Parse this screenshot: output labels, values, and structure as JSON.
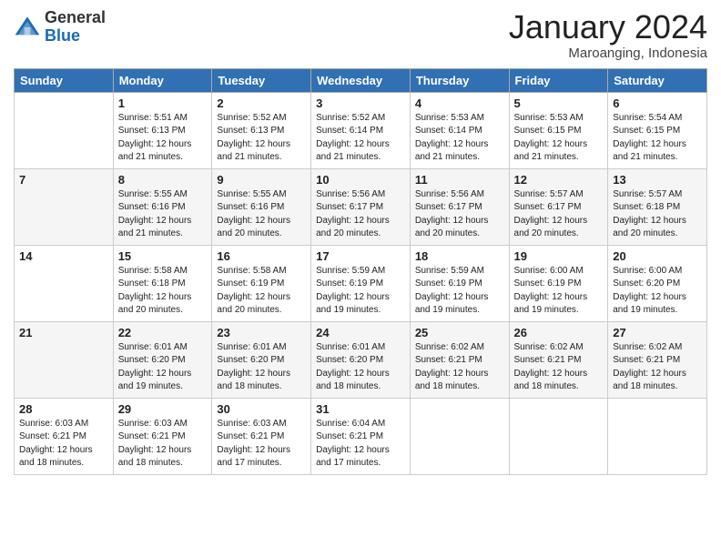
{
  "header": {
    "title": "January 2024",
    "location": "Maroanging, Indonesia",
    "logo_general": "General",
    "logo_blue": "Blue"
  },
  "days": [
    "Sunday",
    "Monday",
    "Tuesday",
    "Wednesday",
    "Thursday",
    "Friday",
    "Saturday"
  ],
  "weeks": [
    [
      {
        "day": "",
        "info": ""
      },
      {
        "day": "1",
        "info": "Sunrise: 5:51 AM\nSunset: 6:13 PM\nDaylight: 12 hours\nand 21 minutes."
      },
      {
        "day": "2",
        "info": "Sunrise: 5:52 AM\nSunset: 6:13 PM\nDaylight: 12 hours\nand 21 minutes."
      },
      {
        "day": "3",
        "info": "Sunrise: 5:52 AM\nSunset: 6:14 PM\nDaylight: 12 hours\nand 21 minutes."
      },
      {
        "day": "4",
        "info": "Sunrise: 5:53 AM\nSunset: 6:14 PM\nDaylight: 12 hours\nand 21 minutes."
      },
      {
        "day": "5",
        "info": "Sunrise: 5:53 AM\nSunset: 6:15 PM\nDaylight: 12 hours\nand 21 minutes."
      },
      {
        "day": "6",
        "info": "Sunrise: 5:54 AM\nSunset: 6:15 PM\nDaylight: 12 hours\nand 21 minutes."
      }
    ],
    [
      {
        "day": "7",
        "info": ""
      },
      {
        "day": "8",
        "info": "Sunrise: 5:55 AM\nSunset: 6:16 PM\nDaylight: 12 hours\nand 21 minutes."
      },
      {
        "day": "9",
        "info": "Sunrise: 5:55 AM\nSunset: 6:16 PM\nDaylight: 12 hours\nand 20 minutes."
      },
      {
        "day": "10",
        "info": "Sunrise: 5:56 AM\nSunset: 6:17 PM\nDaylight: 12 hours\nand 20 minutes."
      },
      {
        "day": "11",
        "info": "Sunrise: 5:56 AM\nSunset: 6:17 PM\nDaylight: 12 hours\nand 20 minutes."
      },
      {
        "day": "12",
        "info": "Sunrise: 5:57 AM\nSunset: 6:17 PM\nDaylight: 12 hours\nand 20 minutes."
      },
      {
        "day": "13",
        "info": "Sunrise: 5:57 AM\nSunset: 6:18 PM\nDaylight: 12 hours\nand 20 minutes."
      }
    ],
    [
      {
        "day": "14",
        "info": ""
      },
      {
        "day": "15",
        "info": "Sunrise: 5:58 AM\nSunset: 6:18 PM\nDaylight: 12 hours\nand 20 minutes."
      },
      {
        "day": "16",
        "info": "Sunrise: 5:58 AM\nSunset: 6:19 PM\nDaylight: 12 hours\nand 20 minutes."
      },
      {
        "day": "17",
        "info": "Sunrise: 5:59 AM\nSunset: 6:19 PM\nDaylight: 12 hours\nand 19 minutes."
      },
      {
        "day": "18",
        "info": "Sunrise: 5:59 AM\nSunset: 6:19 PM\nDaylight: 12 hours\nand 19 minutes."
      },
      {
        "day": "19",
        "info": "Sunrise: 6:00 AM\nSunset: 6:19 PM\nDaylight: 12 hours\nand 19 minutes."
      },
      {
        "day": "20",
        "info": "Sunrise: 6:00 AM\nSunset: 6:20 PM\nDaylight: 12 hours\nand 19 minutes."
      }
    ],
    [
      {
        "day": "21",
        "info": ""
      },
      {
        "day": "22",
        "info": "Sunrise: 6:01 AM\nSunset: 6:20 PM\nDaylight: 12 hours\nand 19 minutes."
      },
      {
        "day": "23",
        "info": "Sunrise: 6:01 AM\nSunset: 6:20 PM\nDaylight: 12 hours\nand 18 minutes."
      },
      {
        "day": "24",
        "info": "Sunrise: 6:01 AM\nSunset: 6:20 PM\nDaylight: 12 hours\nand 18 minutes."
      },
      {
        "day": "25",
        "info": "Sunrise: 6:02 AM\nSunset: 6:21 PM\nDaylight: 12 hours\nand 18 minutes."
      },
      {
        "day": "26",
        "info": "Sunrise: 6:02 AM\nSunset: 6:21 PM\nDaylight: 12 hours\nand 18 minutes."
      },
      {
        "day": "27",
        "info": "Sunrise: 6:02 AM\nSunset: 6:21 PM\nDaylight: 12 hours\nand 18 minutes."
      }
    ],
    [
      {
        "day": "28",
        "info": "Sunrise: 6:03 AM\nSunset: 6:21 PM\nDaylight: 12 hours\nand 18 minutes."
      },
      {
        "day": "29",
        "info": "Sunrise: 6:03 AM\nSunset: 6:21 PM\nDaylight: 12 hours\nand 18 minutes."
      },
      {
        "day": "30",
        "info": "Sunrise: 6:03 AM\nSunset: 6:21 PM\nDaylight: 12 hours\nand 17 minutes."
      },
      {
        "day": "31",
        "info": "Sunrise: 6:04 AM\nSunset: 6:21 PM\nDaylight: 12 hours\nand 17 minutes."
      },
      {
        "day": "",
        "info": ""
      },
      {
        "day": "",
        "info": ""
      },
      {
        "day": "",
        "info": ""
      }
    ]
  ]
}
